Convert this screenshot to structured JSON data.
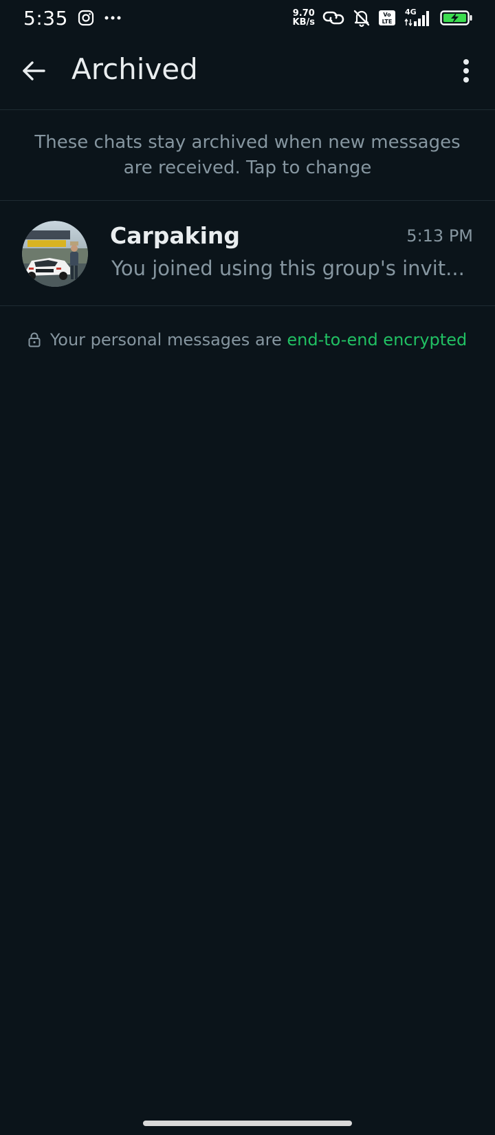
{
  "status_bar": {
    "time": "5:35",
    "net_speed_value": "9.70",
    "net_speed_unit": "KB/s",
    "network_type": "4G",
    "volte_label": "Vo LTE"
  },
  "app_bar": {
    "title": "Archived"
  },
  "banner": {
    "text": "These chats stay archived when new messages are received. Tap to change"
  },
  "chats": [
    {
      "name": "Carpaking",
      "time": "5:13 PM",
      "preview": "You joined using this group's invit..."
    }
  ],
  "encryption_note": {
    "prefix": "Your personal messages are",
    "link": "end-to-end encrypted"
  },
  "colors": {
    "background": "#0b141a",
    "accent_green": "#21c063",
    "secondary_text": "#8696a0"
  }
}
